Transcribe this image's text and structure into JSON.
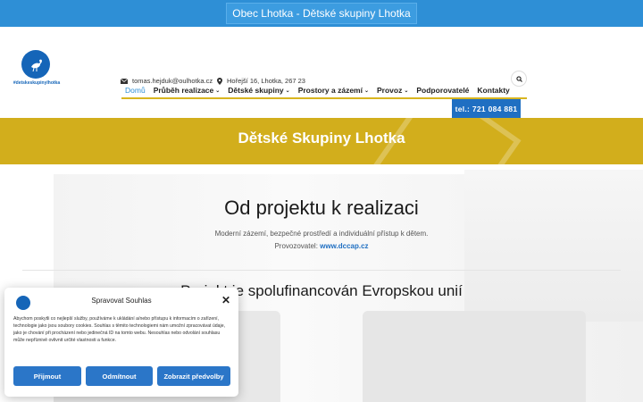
{
  "topbar": {
    "title": "Obec Lhotka - Dětské skupiny Lhotka"
  },
  "logo": {
    "text": "#detskeskupinylhotka",
    "icon": "stork-icon"
  },
  "contact": {
    "email": "tomas.hejduk@oulhotka.cz",
    "address": "Hořejší 16, Lhotka, 267 23"
  },
  "nav": {
    "items": [
      {
        "label": "Domů",
        "active": true,
        "dropdown": false
      },
      {
        "label": "Průběh realizace",
        "active": false,
        "dropdown": true
      },
      {
        "label": "Dětské skupiny",
        "active": false,
        "dropdown": true
      },
      {
        "label": "Prostory a zázemí",
        "active": false,
        "dropdown": true
      },
      {
        "label": "Provoz",
        "active": false,
        "dropdown": true
      },
      {
        "label": "Podporovatelé",
        "active": false,
        "dropdown": false
      },
      {
        "label": "Kontakty",
        "active": false,
        "dropdown": false
      }
    ],
    "caret": "⌄",
    "phone": "tel.: 721 084 881"
  },
  "banner": {
    "title": "Dětské Skupiny Lhotka"
  },
  "main": {
    "heading": "Od projektu k realizaci",
    "subtitle": "Moderní zázemí, bezpečné prostředí a individuální přístup k dětem.",
    "operator_label": "Provozovatel:",
    "operator_link": "www.dccap.cz",
    "eu_heading": "Projekt je spolufinancován Evropskou unií"
  },
  "cookie": {
    "title": "Spravovat Souhlas",
    "text": "Abychom poskytli co nejlepší služby, používáme k ukládání a/nebo přístupu k informacím o zařízení, technologie jako jsou soubory cookies. Souhlas s těmito technologiemi nám umožní zpracovávat údaje, jako je chování při procházení nebo jedinečná ID na tomto webu. Nesouhlas nebo odvolání souhlasu může nepříznivě ovlivnit určité vlastnosti a funkce.",
    "close": "✕",
    "accept": "Přijmout",
    "deny": "Odmítnout",
    "preferences": "Zobrazit předvolby"
  },
  "colors": {
    "topbar": "#2e8fd6",
    "accent_gold": "#d2ae1c",
    "brand_blue": "#1f6fc2"
  }
}
